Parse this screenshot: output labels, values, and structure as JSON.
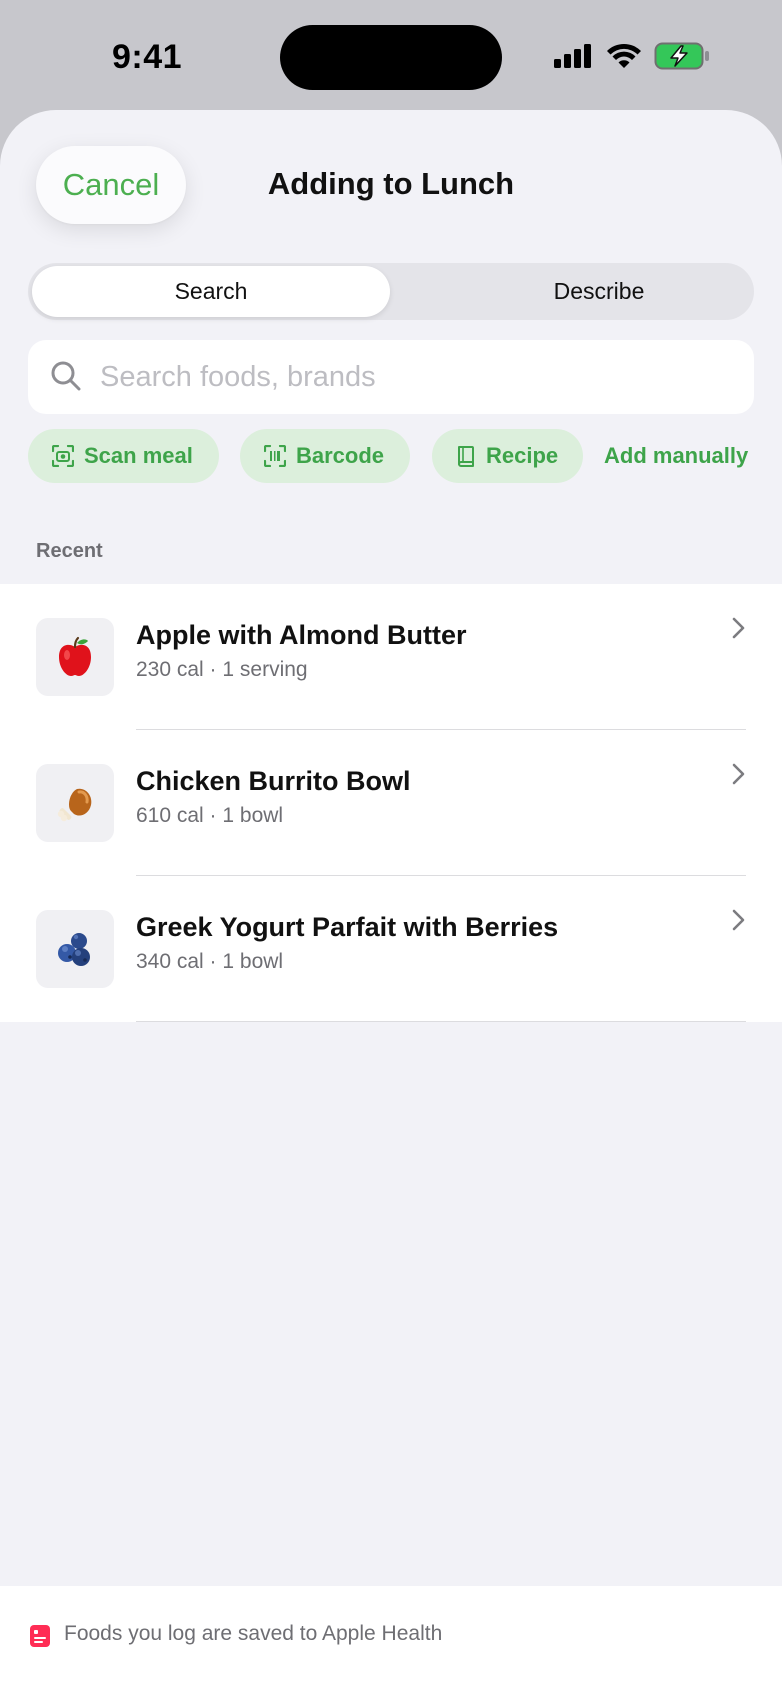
{
  "status_bar": {
    "time": "9:41"
  },
  "header": {
    "cancel_label": "Cancel",
    "title": "Adding to Lunch"
  },
  "segments": [
    {
      "label": "Search",
      "selected": true
    },
    {
      "label": "Describe",
      "selected": false
    }
  ],
  "search": {
    "placeholder": "Search foods, brands",
    "value": ""
  },
  "actions": {
    "scan_meal": "Scan meal",
    "barcode": "Barcode",
    "recipe": "Recipe",
    "add_manually": "Add manually"
  },
  "recent": {
    "label": "Recent",
    "items": [
      {
        "name": "Apple with Almond Butter",
        "detail": "230 cal · 1 serving",
        "icon": "apple-icon"
      },
      {
        "name": "Chicken Burrito Bowl",
        "detail": "610 cal · 1 bowl",
        "icon": "chicken-leg-icon"
      },
      {
        "name": "Greek Yogurt Parfait with Berries",
        "detail": "340 cal · 1 bowl",
        "icon": "blueberries-icon"
      }
    ]
  },
  "footer": {
    "text": "Foods you log are saved to Apple Health"
  },
  "colors": {
    "accent": "#3ea44a",
    "chip_bg": "#dcefdc",
    "sheet_bg": "#f2f2f7",
    "health_red": "#ff2d55"
  }
}
